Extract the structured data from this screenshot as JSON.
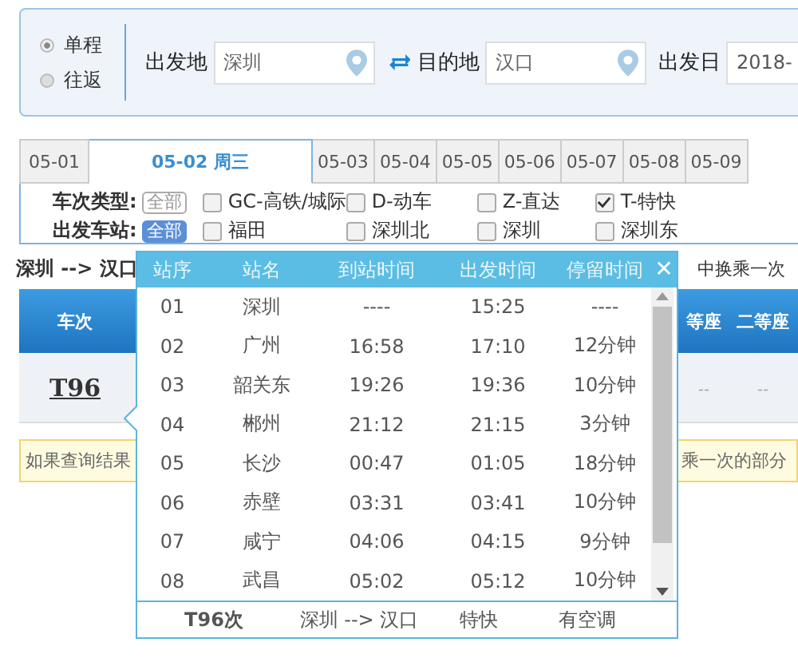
{
  "trip_type": [
    {
      "label": "单程",
      "selected": true
    },
    {
      "label": "往返",
      "selected": false
    }
  ],
  "from": {
    "label": "出发地",
    "value": "深圳"
  },
  "to": {
    "label": "目的地",
    "value": "汉口"
  },
  "date": {
    "label": "出发日",
    "value": "2018-"
  },
  "date_tabs": [
    {
      "label": "05-01",
      "selected": false
    },
    {
      "label": "05-02 周三",
      "selected": true
    },
    {
      "label": "05-03",
      "selected": false
    },
    {
      "label": "05-04",
      "selected": false
    },
    {
      "label": "05-05",
      "selected": false
    },
    {
      "label": "05-06",
      "selected": false
    },
    {
      "label": "05-07",
      "selected": false
    },
    {
      "label": "05-08",
      "selected": false
    },
    {
      "label": "05-09",
      "selected": false
    }
  ],
  "train_types": {
    "label": "车次类型:",
    "all": {
      "label": "全部",
      "selected": false
    },
    "options": [
      {
        "label": "GC-高铁/城际",
        "checked": false
      },
      {
        "label": "D-动车",
        "checked": false
      },
      {
        "label": "Z-直达",
        "checked": false
      },
      {
        "label": "T-特快",
        "checked": true
      }
    ]
  },
  "departure_stations": {
    "label": "出发车站:",
    "all": {
      "label": "全部",
      "selected": true
    },
    "options": [
      {
        "label": "福田",
        "checked": false
      },
      {
        "label": "深圳北",
        "checked": false
      },
      {
        "label": "深圳",
        "checked": false
      },
      {
        "label": "深圳东",
        "checked": false
      }
    ]
  },
  "route": "深圳 --> 汉口",
  "transfer_note": "中换乘一次",
  "table": {
    "columns": [
      "车次",
      "等座",
      "二等座"
    ],
    "rows": [
      {
        "cells": [
          "T96",
          "--",
          "--"
        ]
      }
    ]
  },
  "notice": {
    "left": "如果查询结果",
    "right": "乘一次的部分"
  },
  "stops_popup": {
    "columns": [
      "站序",
      "站名",
      "到站时间",
      "出发时间",
      "停留时间"
    ],
    "close": "✕",
    "rows": [
      {
        "seq": "01",
        "station": "深圳",
        "arrive": "----",
        "depart": "15:25",
        "stay": "----"
      },
      {
        "seq": "02",
        "station": "广州",
        "arrive": "16:58",
        "depart": "17:10",
        "stay": "12分钟"
      },
      {
        "seq": "03",
        "station": "韶关东",
        "arrive": "19:26",
        "depart": "19:36",
        "stay": "10分钟"
      },
      {
        "seq": "04",
        "station": "郴州",
        "arrive": "21:12",
        "depart": "21:15",
        "stay": "3分钟"
      },
      {
        "seq": "05",
        "station": "长沙",
        "arrive": "00:47",
        "depart": "01:05",
        "stay": "18分钟"
      },
      {
        "seq": "06",
        "station": "赤壁",
        "arrive": "03:31",
        "depart": "03:41",
        "stay": "10分钟"
      },
      {
        "seq": "07",
        "station": "咸宁",
        "arrive": "04:06",
        "depart": "04:15",
        "stay": "9分钟"
      },
      {
        "seq": "08",
        "station": "武昌",
        "arrive": "05:02",
        "depart": "05:12",
        "stay": "10分钟"
      }
    ],
    "footer": {
      "train": "T96次",
      "route": "深圳 --> 汉口",
      "type": "特快",
      "ac": "有空调"
    }
  }
}
